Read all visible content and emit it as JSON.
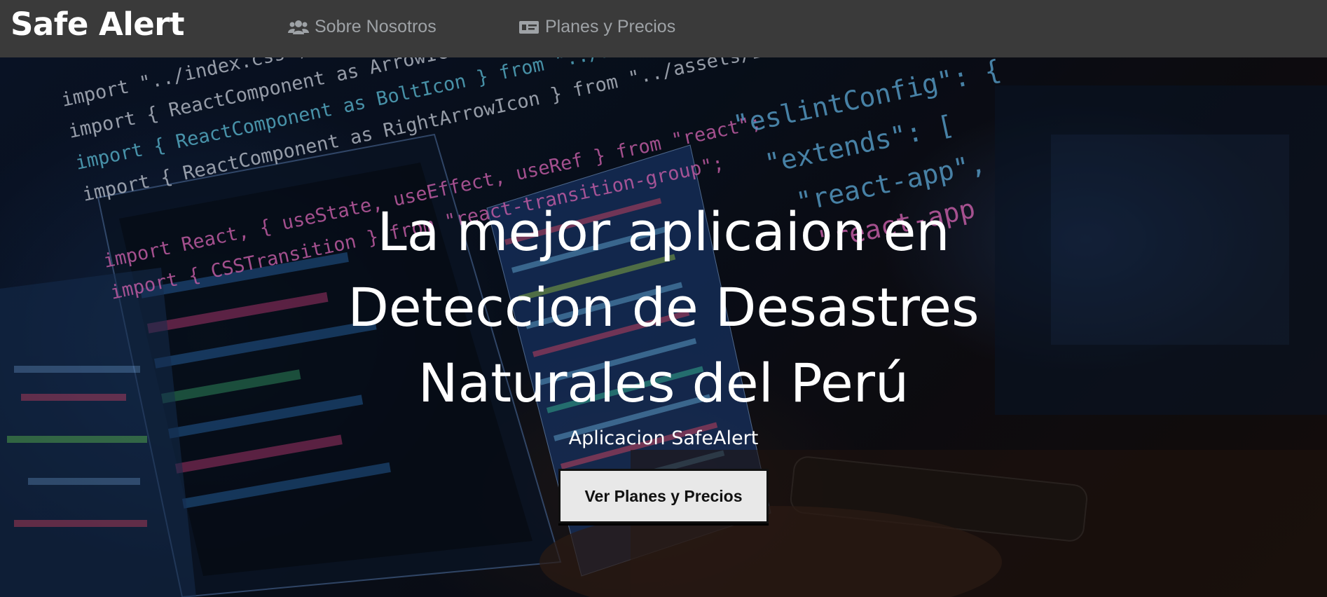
{
  "navbar": {
    "brand": "Safe Alert",
    "links": [
      {
        "label": "Sobre Nosotros",
        "icon": "users-icon"
      },
      {
        "label": "Planes y Precios",
        "icon": "money-bill-icon"
      }
    ]
  },
  "hero": {
    "title_lines": [
      "La mejor aplicaion en",
      "Deteccion de Desastres",
      "Naturales del Perú"
    ],
    "subtitle": "Aplicacion SafeAlert",
    "cta_label": "Ver Planes y Precios",
    "background_code_lines": [
      "import \"../index.css\";",
      "import { ReactComponent as ArrowIcon } from \"../",
      "import { ReactComponent as BoltIcon } from \"../assets/icons/bolt.svg",
      "import { ReactComponent as RightArrowIcon } from \"../assets/icons/right-arrow.svg",
      "import React, { useState, useEffect, useRef } from \"react\";",
      "import { CSSTransition } from \"react-transition-group\";",
      "\"eslintConfig\": {",
      "\"extends\": [",
      "\"react-app\",",
      "\"react-app"
    ],
    "background_code_colors": [
      "#e8f0ff",
      "#6ee0ff",
      "#ff7ad9"
    ]
  },
  "colors": {
    "navbar_bg": "#3a3a3a",
    "brand_text": "#ffffff",
    "nav_link_text": "#9ea2a6",
    "button_bg": "#e8e8e8"
  }
}
